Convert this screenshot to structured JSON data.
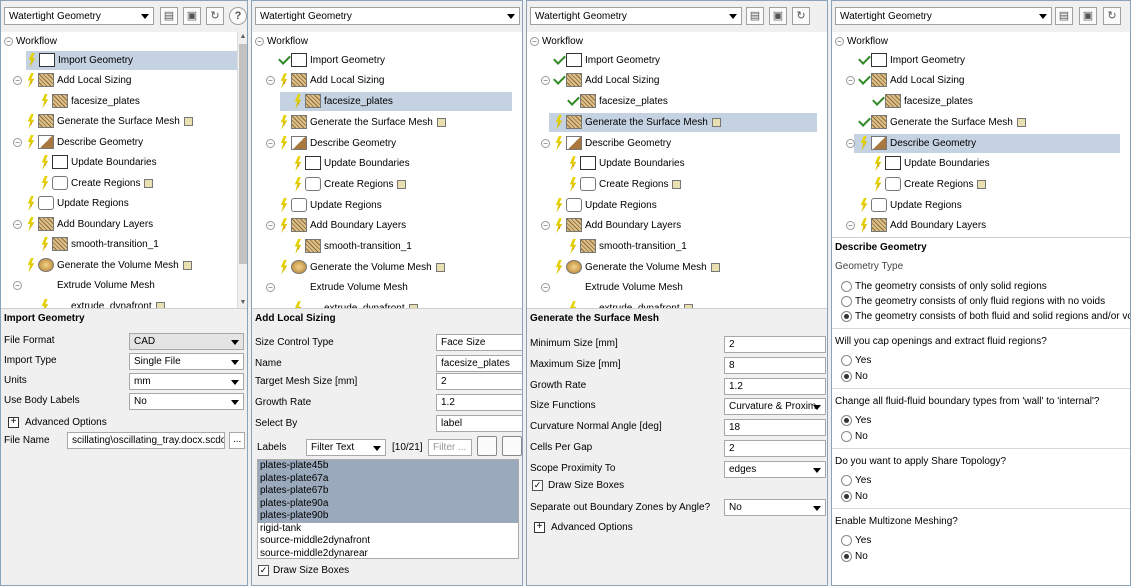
{
  "colors": {
    "selection": "#c5d2e2",
    "list_selection": "#9aaabc",
    "bolt": "#f4e200",
    "check": "#2f8a26"
  },
  "toolbar": {
    "mode": "Watertight Geometry",
    "icons": [
      "folder-icon",
      "save-icon",
      "refresh-icon",
      "help-icon"
    ]
  },
  "workflow_label": "Workflow",
  "panel1": {
    "tree": [
      {
        "label": "Import Geometry",
        "status": "pending",
        "sel": true
      },
      {
        "label": "Add Local Sizing",
        "status": "pending"
      },
      {
        "label": "facesize_plates",
        "status": "pending"
      },
      {
        "label": "Generate the Surface Mesh",
        "status": "pending"
      },
      {
        "label": "Describe Geometry",
        "status": "pending"
      },
      {
        "label": "Update Boundaries",
        "status": "pending"
      },
      {
        "label": "Create Regions",
        "status": "pending"
      },
      {
        "label": "Update Regions",
        "status": "pending"
      },
      {
        "label": "Add Boundary Layers",
        "status": "pending"
      },
      {
        "label": "smooth-transition_1",
        "status": "pending"
      },
      {
        "label": "Generate the Volume Mesh",
        "status": "pending"
      },
      {
        "label": "Extrude Volume Mesh",
        "status": "none"
      },
      {
        "label": "extrude_dynafront",
        "status": "pending"
      }
    ],
    "section": {
      "title": "Import Geometry",
      "fields": [
        {
          "label": "File Format",
          "value": "CAD"
        },
        {
          "label": "Import Type",
          "value": "Single File"
        },
        {
          "label": "Units",
          "value": "mm"
        },
        {
          "label": "Use Body Labels",
          "value": "No"
        }
      ],
      "advanced": "Advanced Options",
      "file_label": "File Name",
      "file_value": "scillating\\oscillating_tray.docx.scdocx",
      "browse": "..."
    }
  },
  "panel2": {
    "tree": [
      {
        "label": "Import Geometry",
        "status": "done"
      },
      {
        "label": "Add Local Sizing",
        "status": "pending"
      },
      {
        "label": "facesize_plates",
        "status": "pending",
        "sel": true
      },
      {
        "label": "Generate the Surface Mesh",
        "status": "pending"
      },
      {
        "label": "Describe Geometry",
        "status": "pending"
      },
      {
        "label": "Update Boundaries",
        "status": "pending"
      },
      {
        "label": "Create Regions",
        "status": "pending"
      },
      {
        "label": "Update Regions",
        "status": "pending"
      },
      {
        "label": "Add Boundary Layers",
        "status": "pending"
      },
      {
        "label": "smooth-transition_1",
        "status": "pending"
      },
      {
        "label": "Generate the Volume Mesh",
        "status": "pending"
      },
      {
        "label": "Extrude Volume Mesh",
        "status": "none"
      },
      {
        "label": "extrude_dynafront",
        "status": "pending"
      }
    ],
    "section": {
      "title": "Add Local Sizing",
      "fields": [
        {
          "label": "Size Control Type",
          "value": "Face Size"
        },
        {
          "label": "Name",
          "value": "facesize_plates"
        },
        {
          "label": "Target Mesh Size [mm]",
          "value": "2"
        },
        {
          "label": "Growth Rate",
          "value": "1.2"
        },
        {
          "label": "Select By",
          "value": "label"
        }
      ],
      "labels_label": "Labels",
      "filter": "Filter Text",
      "count": "[10/21]",
      "filter_placeholder": "Filter ...",
      "list": [
        "plates-plate45b",
        "plates-plate67a",
        "plates-plate67b",
        "plates-plate90a",
        "plates-plate90b",
        "rigid-tank",
        "source-middle2dynafront",
        "source-middle2dynarear"
      ],
      "draw": "Draw Size Boxes"
    }
  },
  "panel3": {
    "tree": [
      {
        "label": "Import Geometry",
        "status": "done"
      },
      {
        "label": "Add Local Sizing",
        "status": "done"
      },
      {
        "label": "facesize_plates",
        "status": "done"
      },
      {
        "label": "Generate the Surface Mesh",
        "status": "pending",
        "sel": true
      },
      {
        "label": "Describe Geometry",
        "status": "pending"
      },
      {
        "label": "Update Boundaries",
        "status": "pending"
      },
      {
        "label": "Create Regions",
        "status": "pending"
      },
      {
        "label": "Update Regions",
        "status": "pending"
      },
      {
        "label": "Add Boundary Layers",
        "status": "pending"
      },
      {
        "label": "smooth-transition_1",
        "status": "pending"
      },
      {
        "label": "Generate the Volume Mesh",
        "status": "pending"
      },
      {
        "label": "Extrude Volume Mesh",
        "status": "none"
      },
      {
        "label": "extrude_dynafront",
        "status": "pending"
      }
    ],
    "section": {
      "title": "Generate the Surface Mesh",
      "fields": [
        {
          "label": "Minimum Size [mm]",
          "value": "2"
        },
        {
          "label": "Maximum Size [mm]",
          "value": "8"
        },
        {
          "label": "Growth Rate",
          "value": "1.2"
        },
        {
          "label": "Size Functions",
          "value": "Curvature & Proxim"
        },
        {
          "label": "Curvature Normal Angle [deg]",
          "value": "18"
        },
        {
          "label": "Cells Per Gap",
          "value": "2"
        },
        {
          "label": "Scope Proximity To",
          "value": "edges"
        }
      ],
      "draw": "Draw Size Boxes",
      "sep_label": "Separate out Boundary Zones by Angle?",
      "sep_value": "No",
      "advanced": "Advanced Options"
    }
  },
  "panel4": {
    "tree": [
      {
        "label": "Import Geometry",
        "status": "done"
      },
      {
        "label": "Add Local Sizing",
        "status": "done"
      },
      {
        "label": "facesize_plates",
        "status": "done"
      },
      {
        "label": "Generate the Surface Mesh",
        "status": "done"
      },
      {
        "label": "Describe Geometry",
        "status": "pending",
        "sel": true
      },
      {
        "label": "Update Boundaries",
        "status": "pending"
      },
      {
        "label": "Create Regions",
        "status": "pending"
      },
      {
        "label": "Update Regions",
        "status": "pending"
      },
      {
        "label": "Add Boundary Layers",
        "status": "pending"
      }
    ],
    "section": {
      "title": "Describe Geometry",
      "geom_type": "Geometry Type",
      "geom_opts": [
        "The geometry consists of only solid regions",
        "The geometry consists of only fluid regions with no voids",
        "The geometry consists of both fluid and solid regions and/or voids"
      ],
      "q1": "Will you cap openings and extract fluid regions?",
      "q2": "Change all fluid-fluid boundary types from 'wall' to 'internal'?",
      "q3": "Do you want to apply Share Topology?",
      "q4": "Enable Multizone Meshing?",
      "yes": "Yes",
      "no": "No"
    }
  }
}
